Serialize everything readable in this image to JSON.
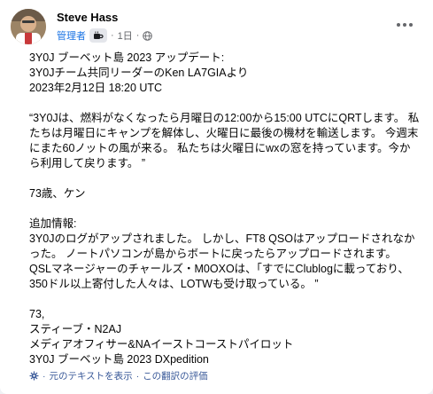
{
  "post": {
    "author": "Steve Hass",
    "role": "管理者",
    "badge_icon": "coffee-cup-icon",
    "time": "1日",
    "separator": "·",
    "paragraphs": [
      "3Y0J ブーベット島 2023 アップデート:\n3Y0Jチーム共同リーダーのKen LA7GIAより\n2023年2月12日 18:20 UTC",
      "“3Y0Jは、燃料がなくなったら月曜日の12:00から15:00 UTCにQRTします。 私たちは月曜日にキャンプを解体し、火曜日に最後の機材を輸送します。 今週末にまた60ノットの風が来る。 私たちは火曜日にwxの窓を持っています。今から利用して戻ります。 ”",
      "73歳、ケン",
      "追加情報:\n3Y0Jのログがアップされました。 しかし、FT8 QSOはアップロードされなかった。 ノートパソコンが島からボートに戻ったらアップロードされます。 QSLマネージャーのチャールズ・M0OXOは、「すでにClublogに載っており、350ドル以上寄付した人々は、LOTWも受け取っている。 ”",
      "73,\nスティーブ・N2AJ\nメディアオフィサー&NAイーストコーストパイロット\n3Y0J ブーベット島 2023 DXpedition"
    ]
  },
  "footer": {
    "see_original": "元のテキストを表示",
    "separator": "·",
    "rate_translation": "この翻訳の評価"
  }
}
